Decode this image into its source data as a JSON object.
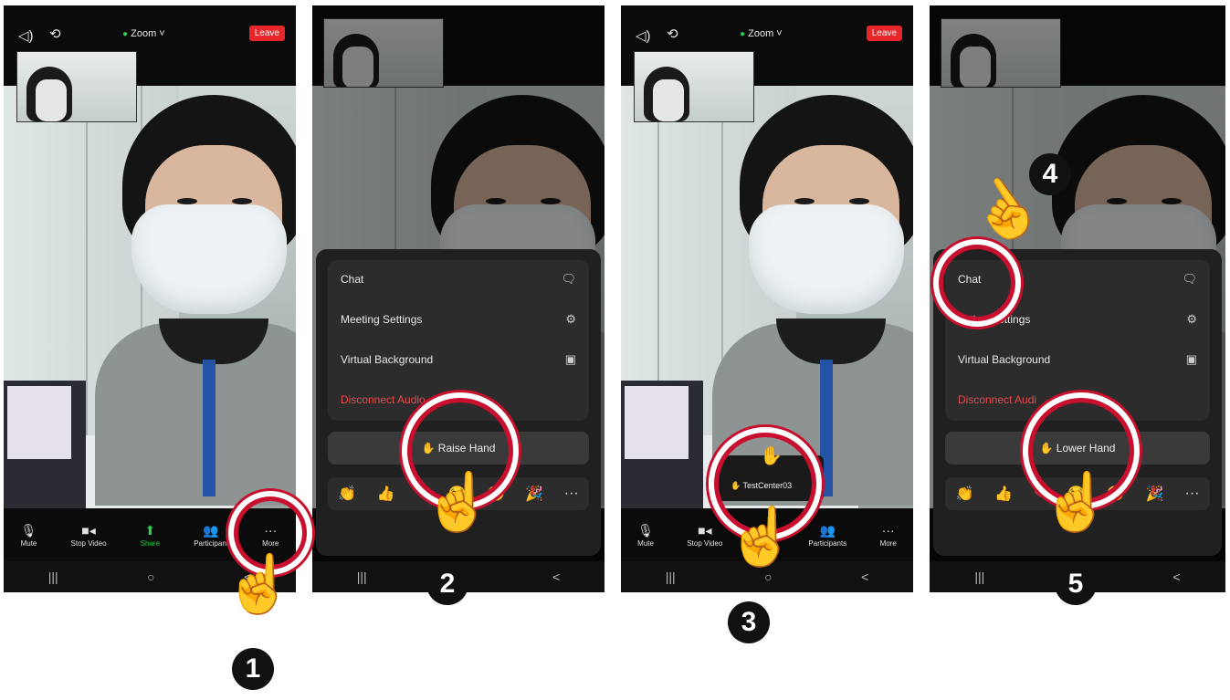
{
  "top_bar": {
    "meeting_name": "Zoom ˅",
    "leave_label": "Leave"
  },
  "toolbar": {
    "mute": "Mute",
    "stop_video": "Stop Video",
    "share": "Share",
    "participants_short": "Participant",
    "participants": "Participants",
    "more": "More"
  },
  "menu": {
    "chat": "Chat",
    "meeting_settings": "Meeting Settings",
    "meeting_settings_partial": "eeting Settings",
    "virtual_background": "Virtual Background",
    "disconnect_audio_partial": "Disconnect Audio",
    "disconnect_audio_short": "Disconnect Audi"
  },
  "hand": {
    "raise": "✋ Raise Hand",
    "lower": "✋ Lower Hand"
  },
  "raised_chip": {
    "user": "TestCenter03"
  },
  "reactions": [
    "👏",
    "👍",
    "❤",
    "😂",
    "😮",
    "🎉",
    "···"
  ],
  "steps": [
    "1",
    "2",
    "3",
    "4",
    "5"
  ],
  "icons": {
    "speaker": "speaker-icon",
    "camera_switch": "camera-switch-icon",
    "chat": "chat-bubble-icon",
    "settings": "gear-icon",
    "vbg": "portrait-icon",
    "pointer": "pointing-hand-icon"
  },
  "colors": {
    "leave": "#e8262a",
    "highlight_ring": "#c8102e",
    "share": "#2dcc4b",
    "disconnect": "#e5484d"
  }
}
